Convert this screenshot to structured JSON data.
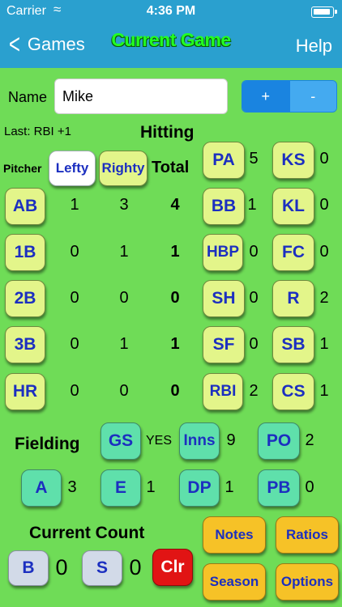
{
  "status": {
    "carrier": "Carrier",
    "time": "4:36 PM"
  },
  "nav": {
    "back": "Games",
    "title": "Current Game",
    "help": "Help"
  },
  "name": {
    "label": "Name",
    "value": "Mike"
  },
  "stepper": {
    "plus": "+",
    "minus": "-"
  },
  "last_action": "Last: RBI +1",
  "hitting_title": "Hitting",
  "pitcher_label": "Pitcher",
  "total_label": "Total",
  "pitcher_buttons": {
    "lefty": "Lefty",
    "righty": "Righty"
  },
  "hitting_rows": [
    {
      "label": "AB",
      "lefty": "1",
      "righty": "3",
      "total": "4"
    },
    {
      "label": "1B",
      "lefty": "0",
      "righty": "1",
      "total": "1"
    },
    {
      "label": "2B",
      "lefty": "0",
      "righty": "0",
      "total": "0"
    },
    {
      "label": "3B",
      "lefty": "0",
      "righty": "1",
      "total": "1"
    },
    {
      "label": "HR",
      "lefty": "0",
      "righty": "0",
      "total": "0"
    }
  ],
  "stats": [
    {
      "label": "PA",
      "value": "5"
    },
    {
      "label": "KS",
      "value": "0"
    },
    {
      "label": "BB",
      "value": "1"
    },
    {
      "label": "KL",
      "value": "0"
    },
    {
      "label": "HBP",
      "value": "0"
    },
    {
      "label": "FC",
      "value": "0"
    },
    {
      "label": "SH",
      "value": "0"
    },
    {
      "label": "R",
      "value": "2"
    },
    {
      "label": "SF",
      "value": "0"
    },
    {
      "label": "SB",
      "value": "1"
    },
    {
      "label": "RBI",
      "value": "2"
    },
    {
      "label": "CS",
      "value": "1"
    }
  ],
  "fielding": {
    "title": "Fielding",
    "gs": {
      "label": "GS",
      "value": "YES"
    },
    "inns": {
      "label": "Inns",
      "value": "9"
    },
    "po": {
      "label": "PO",
      "value": "2"
    },
    "a": {
      "label": "A",
      "value": "3"
    },
    "e": {
      "label": "E",
      "value": "1"
    },
    "dp": {
      "label": "DP",
      "value": "1"
    },
    "pb": {
      "label": "PB",
      "value": "0"
    }
  },
  "count": {
    "title": "Current Count",
    "b": {
      "label": "B",
      "value": "0"
    },
    "s": {
      "label": "S",
      "value": "0"
    },
    "clr": "Clr"
  },
  "menu": {
    "notes": "Notes",
    "ratios": "Ratios",
    "season": "Season",
    "options": "Options"
  },
  "colors": {
    "bar": "#2aa0cf",
    "background": "#6fdc57",
    "title": "#22ff22",
    "accent": "#1a84e0"
  }
}
